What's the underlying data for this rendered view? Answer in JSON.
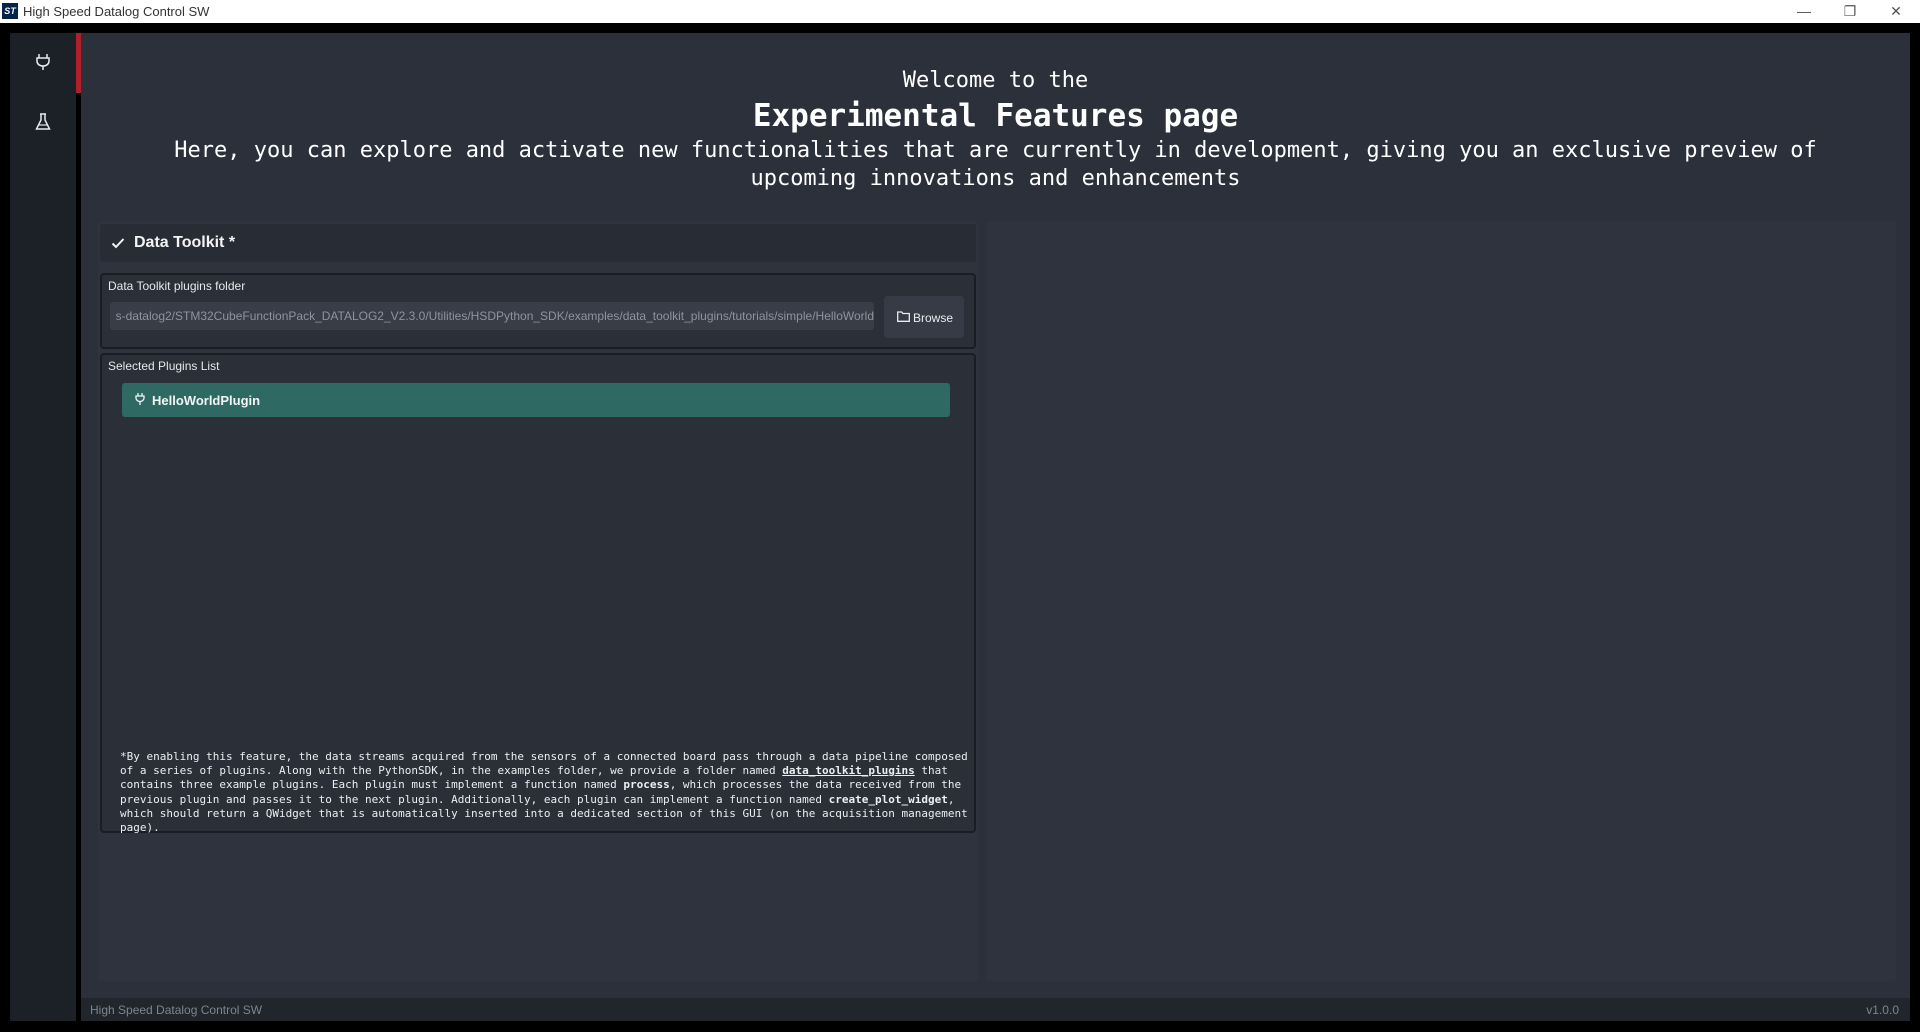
{
  "window": {
    "title": "High Speed Datalog Control SW",
    "logo": "ST",
    "controls": {
      "minimize": "—",
      "restore": "❐",
      "close": "✕"
    }
  },
  "sidebar": {
    "items": [
      {
        "icon": "plug-icon",
        "active": true
      },
      {
        "icon": "flask-icon",
        "active": false
      }
    ],
    "accent_color": "#b11f2a"
  },
  "header": {
    "line1": "Welcome to the",
    "line2": "Experimental Features page",
    "line3": "Here, you can explore and activate new functionalities that are currently in development, giving you an exclusive preview of upcoming innovations and enhancements"
  },
  "data_toolkit": {
    "title": "Data Toolkit *",
    "checked": true,
    "folder_label": "Data Toolkit plugins folder",
    "folder_value": "s-datalog2/STM32CubeFunctionPack_DATALOG2_V2.3.0/Utilities/HSDPython_SDK/examples/data_toolkit_plugins/tutorials/simple/HelloWorld",
    "browse_label": "Browse",
    "plugins_label": "Selected Plugins List",
    "plugins": [
      "HelloWorldPlugin"
    ],
    "plugin_color": "#2e6a63"
  },
  "note": {
    "star": "*",
    "p1": "By enabling this feature, the data streams acquired from the sensors of a connected board pass through a data pipeline composed of a series of plugins. Along with the PythonSDK, in the examples folder, we provide a folder named ",
    "folder_name": "data_toolkit_plugins",
    "p2": " that contains three example plugins. Each plugin must implement a function named ",
    "fn1": "process",
    "p3": ", which processes the data received from the previous plugin and passes it to the next plugin. Additionally, each plugin can implement a function named ",
    "fn2": "create_plot_widget",
    "p4": ", which should return a QWidget that is automatically inserted into a dedicated section of this GUI (on the acquisition management page)."
  },
  "statusbar": {
    "left": "High Speed Datalog Control SW",
    "right": "v1.0.0"
  }
}
